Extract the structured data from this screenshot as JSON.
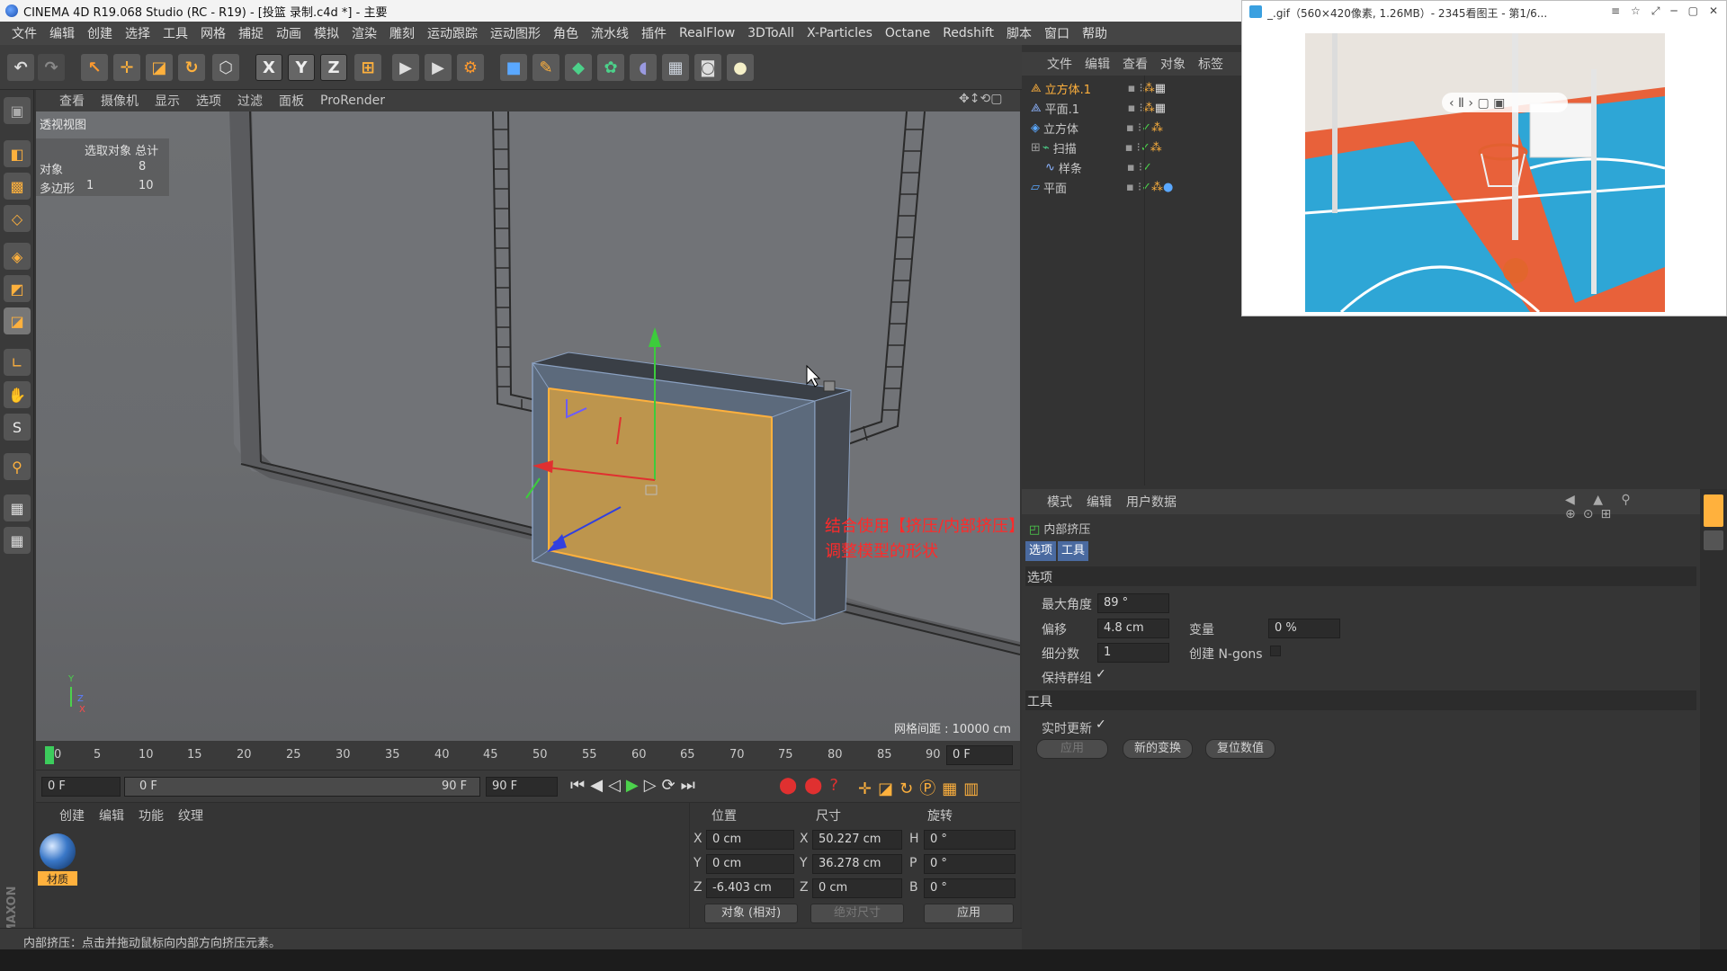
{
  "window": {
    "title": "CINEMA 4D R19.068 Studio (RC - R19) - [投篮 录制.c4d *] - 主要"
  },
  "menu": [
    "文件",
    "编辑",
    "创建",
    "选择",
    "工具",
    "网格",
    "捕捉",
    "动画",
    "模拟",
    "渲染",
    "雕刻",
    "运动跟踪",
    "运动图形",
    "角色",
    "流水线",
    "插件",
    "RealFlow",
    "3DToAll",
    "X-Particles",
    "Octane",
    "Redshift",
    "脚本",
    "窗口",
    "帮助"
  ],
  "toolbar": {
    "x": "X",
    "y": "Y",
    "z": "Z"
  },
  "viewport": {
    "menu": [
      "查看",
      "摄像机",
      "显示",
      "选项",
      "过滤",
      "面板",
      "ProRender"
    ],
    "label": "透视视图",
    "stats_header": "选取对象 总计",
    "stats": [
      {
        "label": "对象",
        "selected": "",
        "total": "8"
      },
      {
        "label": "多边形",
        "selected": "1",
        "total": "10"
      }
    ],
    "grid_spacing": "网格间距 : 10000 cm",
    "annotation_line1": "结合使用【挤压/内部挤压】",
    "annotation_line2": "调整模型的形状",
    "axis_y": "Y",
    "axis_z": "Z",
    "axis_x": "X"
  },
  "timeline": {
    "ticks": [
      "0",
      "5",
      "10",
      "15",
      "20",
      "25",
      "30",
      "35",
      "40",
      "45",
      "50",
      "55",
      "60",
      "65",
      "70",
      "75",
      "80",
      "85",
      "90"
    ],
    "current_frame": "0 F"
  },
  "playback": {
    "start": "0 F",
    "range_start": "0 F",
    "range_end": "90 F",
    "end": "90 F"
  },
  "material_panel": {
    "menu": [
      "创建",
      "编辑",
      "功能",
      "纹理"
    ],
    "material_name": "材质"
  },
  "coord_panel": {
    "headers": [
      "位置",
      "尺寸",
      "旋转"
    ],
    "rows": [
      {
        "axis": "X",
        "pos": "0 cm",
        "size_axis": "X",
        "size": "50.227 cm",
        "rot_axis": "H",
        "rot": "0 °"
      },
      {
        "axis": "Y",
        "pos": "0 cm",
        "size_axis": "Y",
        "size": "36.278 cm",
        "rot_axis": "P",
        "rot": "0 °"
      },
      {
        "axis": "Z",
        "pos": "-6.403 cm",
        "size_axis": "Z",
        "size": "0 cm",
        "rot_axis": "B",
        "rot": "0 °"
      }
    ],
    "mode": "对象 (相对)",
    "size_mode": "绝对尺寸",
    "apply": "应用"
  },
  "status": "内部挤压：点击并拖动鼠标向内部方向挤压元素。",
  "object_manager": {
    "menu": [
      "文件",
      "编辑",
      "查看",
      "对象",
      "标签"
    ],
    "objects": [
      "立方体.1",
      "平面.1",
      "立方体",
      "扫描",
      "样条",
      "平面"
    ]
  },
  "attribute_manager": {
    "menu": [
      "模式",
      "编辑",
      "用户数据"
    ],
    "tool_name": "内部挤压",
    "tabs": [
      "选项",
      "工具"
    ],
    "section_options": "选项",
    "max_angle_label": "最大角度",
    "max_angle": "89 °",
    "offset_label": "偏移",
    "offset": "4.8 cm",
    "variance_label": "变量",
    "variance": "0 %",
    "subdiv_label": "细分数",
    "subdiv": "1",
    "ngons_label": "创建 N-gons",
    "keep_groups_label": "保持群组",
    "section_tool": "工具",
    "realtime_label": "实时更新",
    "apply_btn": "应用",
    "new_transform_btn": "新的变换",
    "reset_btn": "复位数值"
  },
  "image_viewer": {
    "title": "_.gif（560×420像素, 1.26MB）- 2345看图王 - 第1/6..."
  }
}
